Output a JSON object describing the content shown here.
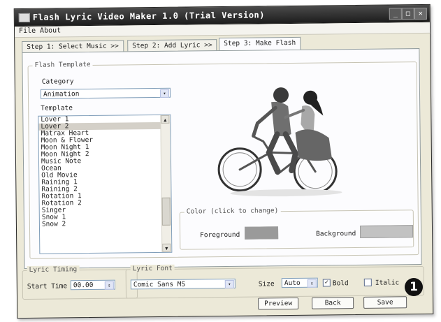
{
  "window": {
    "title": "Flash Lyric Video Maker 1.0 (Trial Version)",
    "controls": {
      "minimize": "_",
      "maximize": "□",
      "close": "✕"
    }
  },
  "menu": [
    "File",
    "About"
  ],
  "tabs": [
    {
      "label": "Step 1: Select Music >>",
      "active": false
    },
    {
      "label": "Step 2: Add Lyric >>",
      "active": false
    },
    {
      "label": "Step 3: Make Flash",
      "active": true
    }
  ],
  "flash_template": {
    "group_title": "Flash Template",
    "category_label": "Category",
    "category_value": "Animation",
    "template_label": "Template",
    "templates": [
      "Lover 1",
      "Lover 2",
      "Matrax Heart",
      "Moon & Flower",
      "Moon Night 1",
      "Moon Night 2",
      "Music Note",
      "Ocean",
      "Old Movie",
      "Raining 1",
      "Raining 2",
      "Rotation 1",
      "Rotation 2",
      "Singer",
      "Snow 1",
      "Snow 2"
    ],
    "selected_index": 1
  },
  "color": {
    "group_title": "Color (click to change)",
    "foreground_label": "Foreground",
    "background_label": "Background",
    "foreground_color": "#9a9a9a",
    "background_color": "#c2c2c2"
  },
  "lyric_timing": {
    "group_title": "Lyric Timing",
    "start_time_label": "Start Time",
    "start_time_value": "00.00"
  },
  "lyric_font": {
    "group_title": "Lyric Font",
    "font_value": "Comic Sans MS",
    "size_label": "Size",
    "size_value": "Auto",
    "bold_label": "Bold",
    "bold_checked": true,
    "italic_label": "Italic",
    "italic_checked": false
  },
  "buttons": {
    "preview": "Preview",
    "back": "Back",
    "save": "Save"
  },
  "annotation": {
    "number": "1"
  },
  "icons": {
    "checkmark": "✓",
    "combo_arrow": "▾",
    "spin_arrow": "⇕",
    "scroll_up": "▲",
    "scroll_down": "▼"
  }
}
